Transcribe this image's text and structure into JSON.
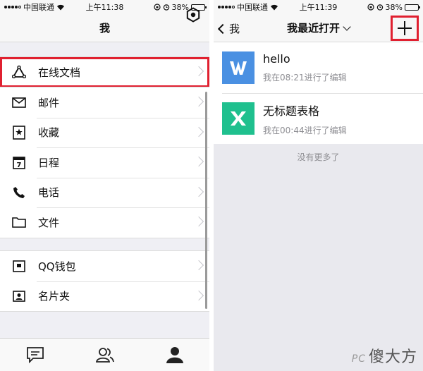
{
  "left": {
    "status": {
      "carrier": "中国联通",
      "time": "上午11:38",
      "battery": "38%",
      "battery_level": 0.38
    },
    "title": "我",
    "group1": [
      {
        "label": "在线文档",
        "icon": "triangle-icon"
      }
    ],
    "group2": [
      {
        "label": "邮件",
        "icon": "mail-icon"
      },
      {
        "label": "收藏",
        "icon": "bookmark-icon"
      },
      {
        "label": "日程",
        "icon": "calendar-icon",
        "day": "7"
      },
      {
        "label": "电话",
        "icon": "phone-icon"
      },
      {
        "label": "文件",
        "icon": "folder-icon"
      }
    ],
    "group3": [
      {
        "label": "QQ钱包",
        "icon": "wallet-icon"
      },
      {
        "label": "名片夹",
        "icon": "card-icon"
      }
    ],
    "tabs": [
      {
        "name": "messages",
        "icon": "chat-icon"
      },
      {
        "name": "contacts",
        "icon": "contacts-icon"
      },
      {
        "name": "me",
        "icon": "person-icon"
      }
    ]
  },
  "right": {
    "status": {
      "carrier": "中国联通",
      "time": "上午11:39",
      "battery": "38%",
      "battery_level": 0.38
    },
    "back_label": "我",
    "title": "我最近打开",
    "docs": [
      {
        "name": "hello",
        "meta": "我在08:21进行了编辑",
        "thumb_letter": "W",
        "color": "#4a90e2"
      },
      {
        "name": "无标题表格",
        "meta": "我在00:44进行了编辑",
        "thumb_letter": "X",
        "color": "#1fc08e"
      }
    ],
    "empty_text": "没有更多了"
  },
  "watermark": {
    "prefix": "PC",
    "text": "傻大方"
  },
  "colors": {
    "highlight": "#e02030",
    "doc_blue": "#4a90e2",
    "sheet_green": "#1fc08e"
  }
}
